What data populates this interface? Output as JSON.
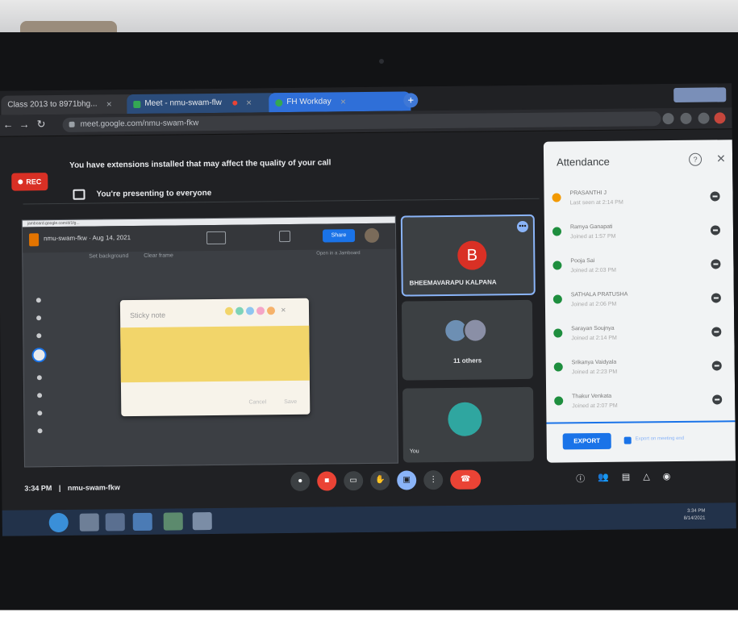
{
  "browser": {
    "tabs": [
      {
        "label": "Class 2013 to 8971bhg...",
        "active": false
      },
      {
        "label": "Meet - nmu-swam-flw",
        "active": true
      },
      {
        "label": "FH Workday",
        "active": false
      }
    ],
    "url": "meet.google.com/nmu-swam-fkw"
  },
  "meet": {
    "extension_notice": "You have extensions installed that may affect the quality of your call",
    "rec_label": "REC",
    "presenting_text": "You're presenting to everyone",
    "meeting_time": "3:34 PM",
    "meeting_code": "nmu-swam-fkw"
  },
  "shared_screen": {
    "url_strip": "jamboard.google.com/d/1fg...",
    "doc_title": "nmu-swam-fkw · Aug 14, 2021",
    "share_label": "Share",
    "set_background": "Set background",
    "clear_frame": "Clear frame",
    "open_in_jamboard": "Open in a Jamboard",
    "sticky_title": "Sticky note",
    "sticky_cancel": "Cancel",
    "sticky_save": "Save"
  },
  "participants": {
    "main_name": "BHEEMAVARAPU KALPANA",
    "main_initial": "B",
    "others_label": "11 others",
    "self_label": "You"
  },
  "attendance": {
    "title": "Attendance",
    "entries": [
      {
        "name": "PRASANTHI J",
        "time": "Last seen at 2:14 PM",
        "status": "away"
      },
      {
        "name": "Ramya Ganapati",
        "time": "Joined at 1:57 PM",
        "status": "present"
      },
      {
        "name": "Pooja Sai",
        "time": "Joined at 2:03 PM",
        "status": "present"
      },
      {
        "name": "SATHALA PRATUSHA",
        "time": "Joined at 2:06 PM",
        "status": "present"
      },
      {
        "name": "Sarayan Soujnya",
        "time": "Joined at 2:14 PM",
        "status": "present"
      },
      {
        "name": "Srikanya Vaidyala",
        "time": "Joined at 2:23 PM",
        "status": "present"
      },
      {
        "name": "Thakur Venkata",
        "time": "Joined at 2:07 PM",
        "status": "present"
      }
    ],
    "export_label": "EXPORT",
    "export_option": "Export on meeting end"
  },
  "taskbar": {
    "time": "3:34 PM",
    "date": "8/14/2021"
  },
  "colors": {
    "meet_bg": "#202124",
    "tile_bg": "#3c4043",
    "accent_blue": "#1a73e8",
    "rec_red": "#d93025",
    "sticky_yellow": "#f2d56a",
    "present_green": "#1e8e3e",
    "away_orange": "#f29900"
  }
}
